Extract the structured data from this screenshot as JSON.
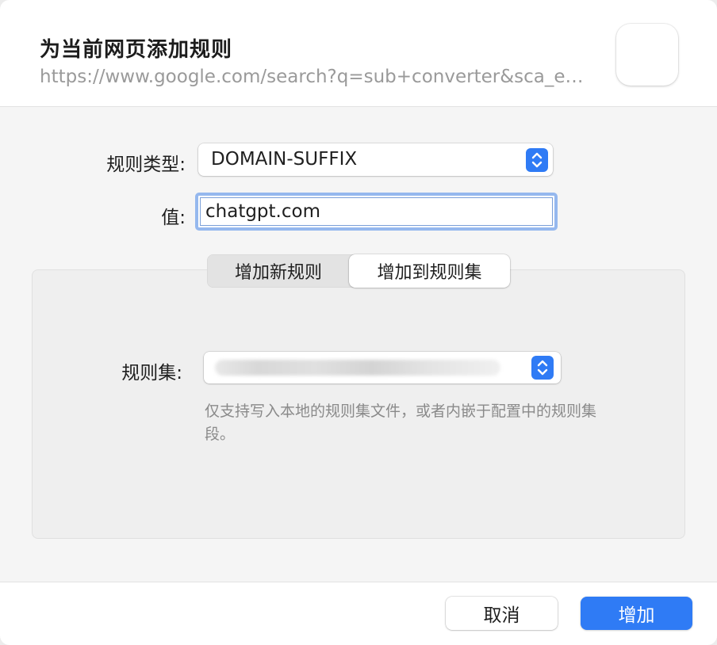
{
  "dialog": {
    "title": "为当前网页添加规则",
    "url": "https://www.google.com/search?q=sub+converter&sca_e…",
    "app_icon": "audio-bars-icon"
  },
  "form": {
    "rule_type_label": "规则类型:",
    "rule_type_value": "DOMAIN-SUFFIX",
    "value_label": "值:",
    "value_input": "chatgpt.com"
  },
  "mode_tabs": [
    {
      "label": "增加新规则",
      "selected": false
    },
    {
      "label": "增加到规则集",
      "selected": true
    }
  ],
  "ruleset": {
    "label": "规则集:",
    "selected_value": "",
    "hint": "仅支持写入本地的规则集文件，或者内嵌于配置中的规则集段。"
  },
  "buttons": {
    "cancel": "取消",
    "add": "增加"
  },
  "colors": {
    "accent": "#2f7bf5",
    "focus_ring": "#95b8ee",
    "secondary_text": "#9a9a9a"
  }
}
